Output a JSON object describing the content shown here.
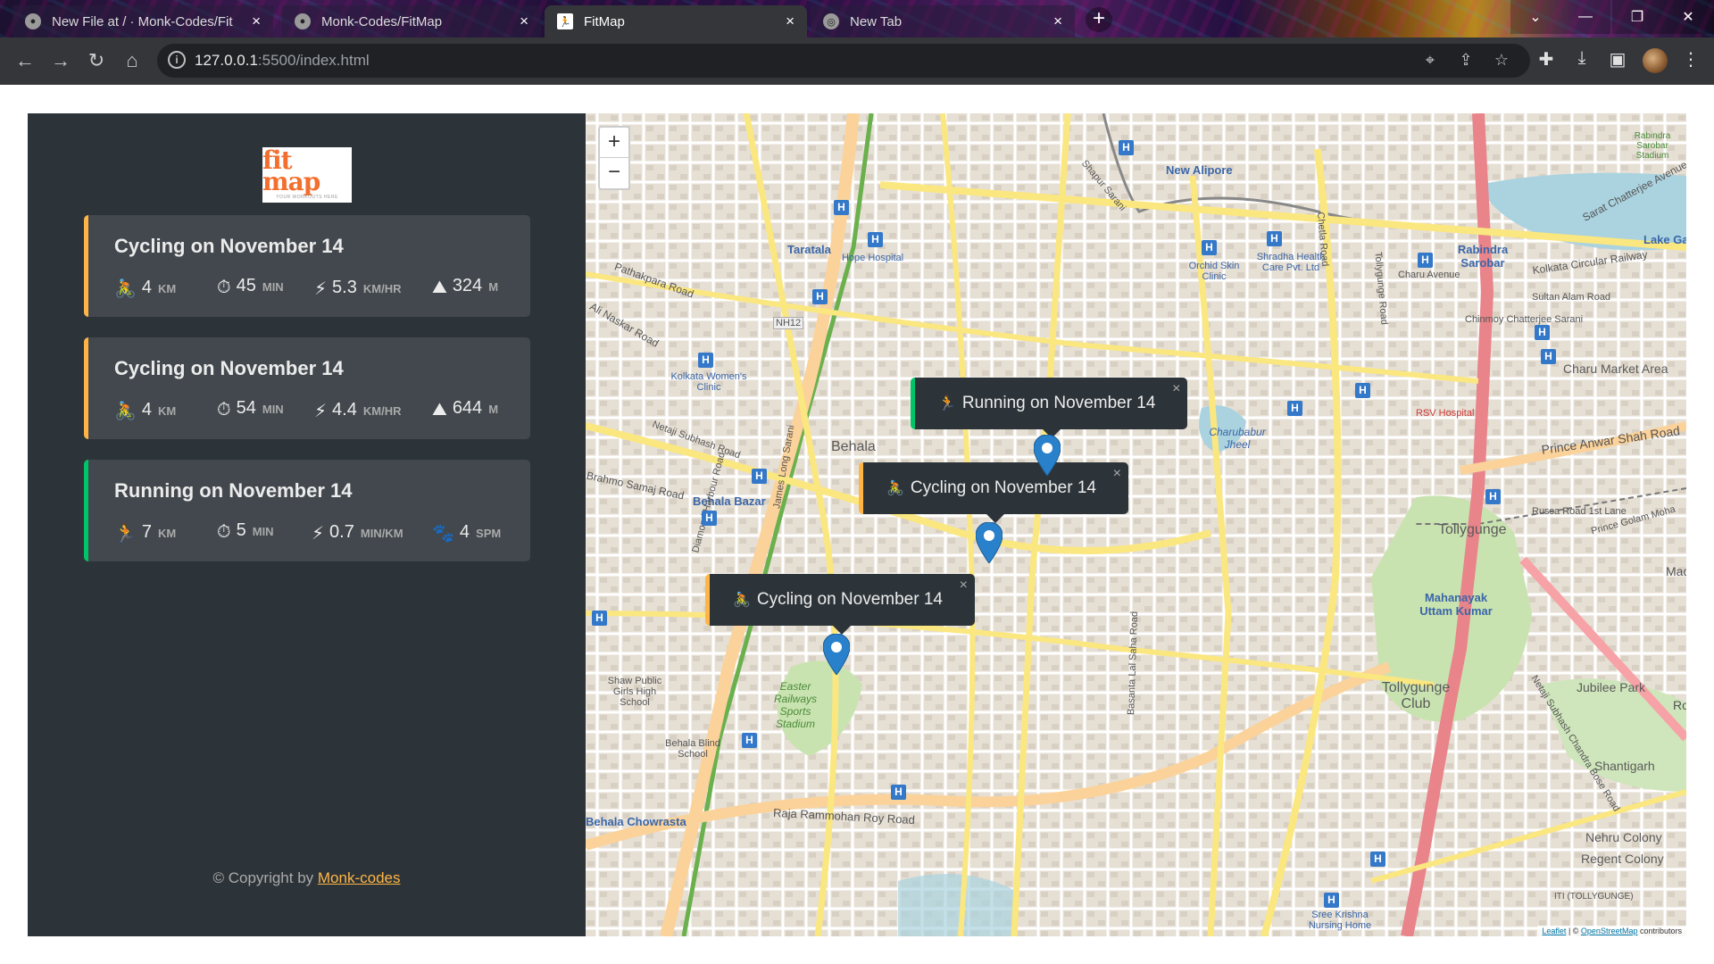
{
  "browser": {
    "tabs": [
      {
        "title": "New File at / · Monk-Codes/Fit",
        "close": "×"
      },
      {
        "title": "Monk-Codes/FitMap",
        "close": "×"
      },
      {
        "title": "FitMap",
        "close": "×"
      },
      {
        "title": "New Tab",
        "close": "×"
      }
    ],
    "newtab": "+",
    "url_host": "127.0.0.1",
    "url_path": ":5500/index.html"
  },
  "sidebar": {
    "logo_text": "fit map",
    "logo_tagline": "YOUR WORKOUTS HERE",
    "workouts": [
      {
        "title": "Cycling on November 14",
        "type": "cycling",
        "details": [
          {
            "icon": "🚴",
            "value": "4",
            "unit": "km"
          },
          {
            "icon": "⏱",
            "value": "45",
            "unit": "min"
          },
          {
            "icon": "⚡",
            "value": "5.3",
            "unit": "km/hr"
          },
          {
            "icon": "⛰",
            "value": "324",
            "unit": "m"
          }
        ]
      },
      {
        "title": "Cycling on November 14",
        "type": "cycling",
        "details": [
          {
            "icon": "🚴",
            "value": "4",
            "unit": "km"
          },
          {
            "icon": "⏱",
            "value": "54",
            "unit": "min"
          },
          {
            "icon": "⚡",
            "value": "4.4",
            "unit": "km/hr"
          },
          {
            "icon": "⛰",
            "value": "644",
            "unit": "m"
          }
        ]
      },
      {
        "title": "Running on November 14",
        "type": "running",
        "details": [
          {
            "icon": "🏃",
            "value": "7",
            "unit": "km"
          },
          {
            "icon": "⏱",
            "value": "5",
            "unit": "min"
          },
          {
            "icon": "⚡",
            "value": "0.7",
            "unit": "min/km"
          },
          {
            "icon": "🐾",
            "value": "4",
            "unit": "spm"
          }
        ]
      }
    ],
    "copyright_prefix": "© Copyright by ",
    "copyright_link": "Monk-codes"
  },
  "map": {
    "zoom_in": "+",
    "zoom_out": "−",
    "attribution_leaflet": "Leaflet",
    "attribution_sep": " | © ",
    "attribution_osm": "OpenStreetMap",
    "attribution_suffix": " contributors",
    "popups": [
      {
        "icon": "🏃",
        "text": "Running on November 14",
        "type": "running"
      },
      {
        "icon": "🚴",
        "text": "Cycling on November 14",
        "type": "cycling"
      },
      {
        "icon": "🚴",
        "text": "Cycling on November 14",
        "type": "cycling"
      }
    ],
    "labels": [
      "New Alipore",
      "Taratala",
      "Hope Hospital",
      "Pathakpara Road",
      "Ali Naskar Road",
      "NH12",
      "Kolkata Women's Clinic",
      "Netaji Subhash Road",
      "Behala",
      "Behala Bazar",
      "Brahmo Samaj Road",
      "Orchid Skin Clinic",
      "Shradha Health Care Pvt. Ltd",
      "Charu Avenue",
      "Rabindra Sarobar",
      "Kolkata Circular Railway",
      "Lake Gar",
      "Sarat Chatterjee Avenue",
      "Sultan Alam Road",
      "Chinmoy Chatterjee Sarani",
      "Charu Market Area",
      "RSV Hospital",
      "Charubabur Jheel",
      "Prince Anwar Shah Road",
      "Russa Road 1st Lane",
      "Tollygunge",
      "Prince Golam Moha",
      "Mahanayak Uttam Kumar",
      "Tollygunge Club",
      "Jubilee Park",
      "Easter Railways Sports Stadium",
      "Shaw Public Girls High School",
      "Behala Blind School",
      "Raja Rammohan Roy Road",
      "Behala Chowrasta",
      "Shantigarh",
      "Nehru Colony",
      "Regent Colony",
      "Sree Krishna Nursing Home",
      "Netaji Subhash Chandra Bose Road",
      "Diamond Harbour Road",
      "James Long Sarani",
      "Basanta Lal Saha Road",
      "Tollygunge Road",
      "Chetla Road",
      "Shapur Sarani",
      "Jubilee Park",
      "Rabindra Sarobar Stadium",
      "Ro",
      "Mada",
      "ITI (TOLLYGUNGE)"
    ]
  }
}
